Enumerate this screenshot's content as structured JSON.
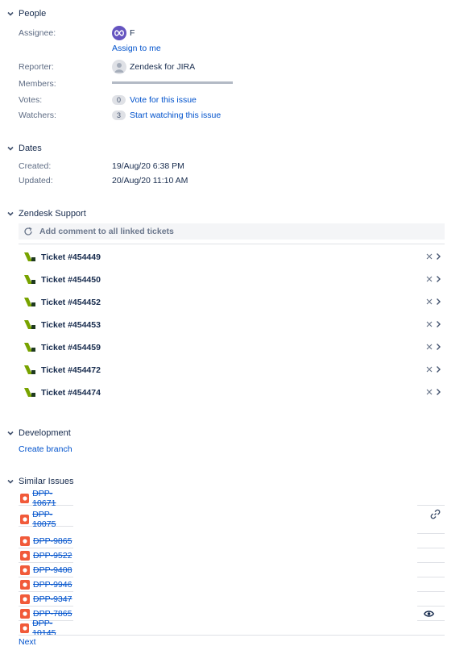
{
  "people": {
    "title": "People",
    "assignee_label": "Assignee:",
    "assignee_name": "F",
    "assign_to_me": "Assign to me",
    "reporter_label": "Reporter:",
    "reporter_name": "Zendesk for JIRA",
    "members_label": "Members:",
    "votes_label": "Votes:",
    "votes_count": "0",
    "vote_link": "Vote for this issue",
    "watchers_label": "Watchers:",
    "watchers_count": "3",
    "watch_link": "Start watching this issue"
  },
  "dates": {
    "title": "Dates",
    "created_label": "Created:",
    "created_value": "19/Aug/20 6:38 PM",
    "updated_label": "Updated:",
    "updated_value": "20/Aug/20 11:10 AM"
  },
  "zendesk": {
    "title": "Zendesk Support",
    "comment_placeholder": "Add comment to all linked tickets",
    "tickets": [
      "Ticket #454449",
      "Ticket #454450",
      "Ticket #454452",
      "Ticket #454453",
      "Ticket #454459",
      "Ticket #454472",
      "Ticket #454474"
    ]
  },
  "development": {
    "title": "Development",
    "create_branch": "Create branch"
  },
  "similar": {
    "title": "Similar Issues",
    "issues": [
      "DPP-10671",
      "DPP-10075",
      "DPP-9865",
      "DPP-9522",
      "DPP-9408",
      "DPP-9946",
      "DPP-9347",
      "DPP-7865",
      "DPP-10145"
    ],
    "next": "Next"
  },
  "colors": {
    "link": "#0052cc",
    "bug": "#f15a3a",
    "zendesk_green": "#78a300"
  }
}
